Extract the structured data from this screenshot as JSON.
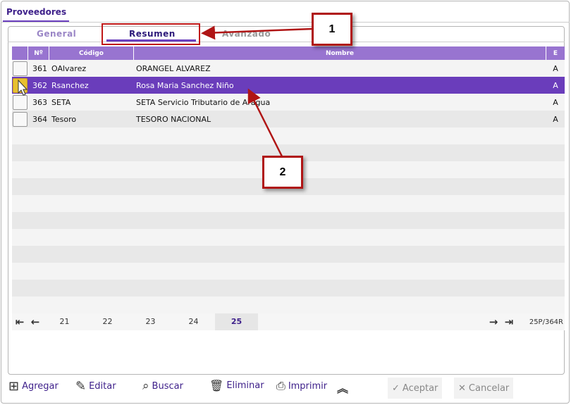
{
  "title": "Proveedores",
  "tabs": [
    "General",
    "Resumen",
    "Avanzado"
  ],
  "columns": [
    "Nº",
    "Código",
    "Nombre",
    "E"
  ],
  "rows": [
    {
      "num": "361",
      "code": "OAlvarez",
      "name": "ORANGEL ALVAREZ",
      "e": "A"
    },
    {
      "num": "362",
      "code": "Rsanchez",
      "name": "Rosa Maria Sanchez Niño",
      "e": "A"
    },
    {
      "num": "363",
      "code": "SETA",
      "name": "SETA Servicio Tributario de Aragua",
      "e": "A"
    },
    {
      "num": "364",
      "code": "Tesoro",
      "name": "TESORO NACIONAL",
      "e": "A"
    }
  ],
  "pager": {
    "pages": [
      "21",
      "22",
      "23",
      "24",
      "25"
    ],
    "current": "25",
    "summary": "25P/364R"
  },
  "actions": {
    "add": "Agregar",
    "edit": "Editar",
    "search": "Buscar",
    "delete": "Eliminar",
    "print": "Imprimir",
    "accept": "Aceptar",
    "cancel": "Cancelar"
  },
  "callouts": [
    "1",
    "2"
  ]
}
